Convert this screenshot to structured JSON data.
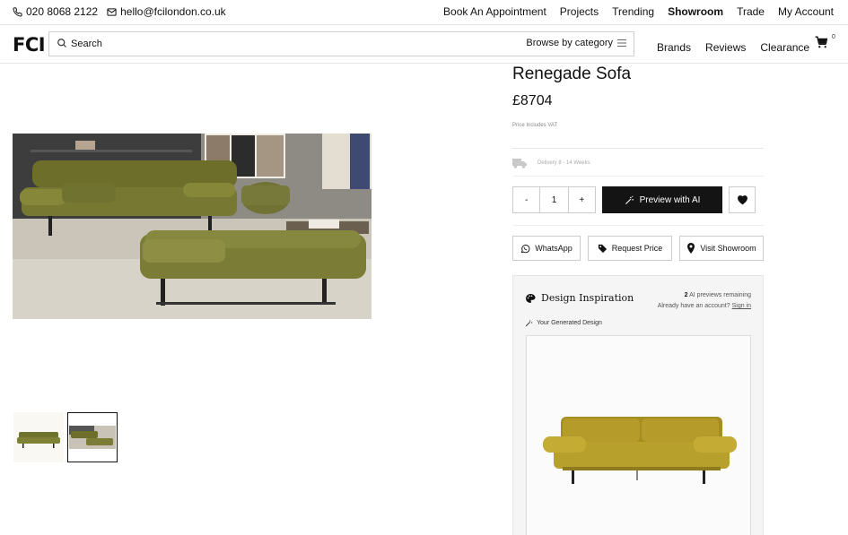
{
  "topbar": {
    "phone": "020 8068 2122",
    "email": "hello@fcilondon.co.uk",
    "links": [
      "Book An Appointment",
      "Projects",
      "Trending",
      "Showroom",
      "Trade",
      "My Account"
    ]
  },
  "header": {
    "logo": "FCI",
    "search_placeholder": "Search",
    "browse_label": "Browse by category",
    "nav": [
      "Brands",
      "Reviews",
      "Clearance"
    ],
    "cart_count": "0"
  },
  "product": {
    "title": "Renegade Sofa",
    "price": "£8704",
    "vat_note": "Price Includes VAT",
    "delivery": "Delivery 8 - 14 Weeks",
    "quantity": "1",
    "minus": "-",
    "plus": "+",
    "preview_label": "Preview with AI",
    "actions": {
      "whatsapp": "WhatsApp",
      "request_price": "Request Price",
      "visit_showroom": "Visit Showroom"
    }
  },
  "design": {
    "title": "Design Inspiration",
    "previews_count": "2",
    "previews_text": "AI previews remaining",
    "account_text": "Already have an account?",
    "signin_label": "Sign in",
    "generated_label": "Your Generated Design"
  },
  "colors": {
    "accent_dark": "#141414",
    "sofa_green": "#7a7a32",
    "sofa_mustard": "#b8a02c"
  }
}
